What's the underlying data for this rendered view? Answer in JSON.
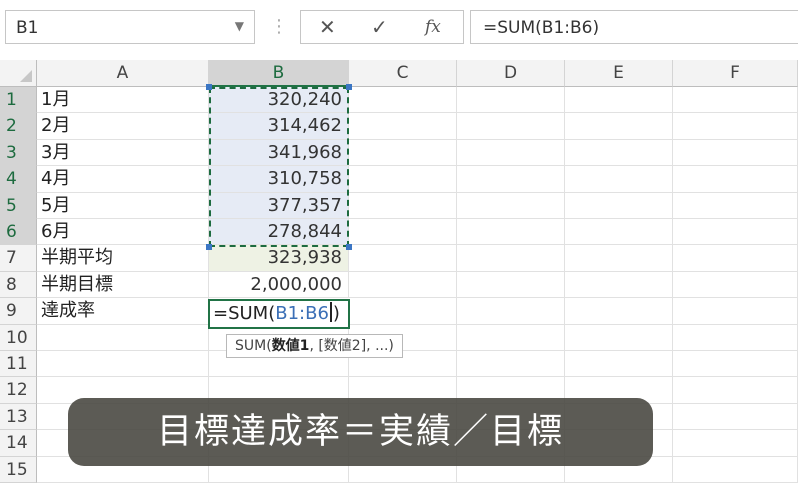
{
  "formula_bar": {
    "name_box": "B1",
    "cancel_icon": "✕",
    "enter_icon": "✓",
    "function_icon": "fx",
    "formula": "=SUM(B1:B6)"
  },
  "columns": [
    "A",
    "B",
    "C",
    "D",
    "E",
    "F"
  ],
  "rows": [
    "1",
    "2",
    "3",
    "4",
    "5",
    "6",
    "7",
    "8",
    "9",
    "10",
    "11",
    "12",
    "13",
    "14",
    "15"
  ],
  "cells": {
    "a": [
      "1月",
      "2月",
      "3月",
      "4月",
      "5月",
      "6月",
      "半期平均",
      "半期目標",
      "達成率"
    ],
    "b": [
      "320,240",
      "314,462",
      "341,968",
      "310,758",
      "377,357",
      "278,844",
      "323,938",
      "2,000,000"
    ]
  },
  "active_cell": {
    "prefix": "=SUM(",
    "ref": "B1:B6",
    "suffix": ")"
  },
  "tooltip": {
    "fn": "SUM(",
    "arg1": "数値1",
    "rest": ", [数値2], ...)"
  },
  "caption": "目標達成率＝実績／目標",
  "colors": {
    "selection_green": "#217346",
    "range_fill": "#e6ebf5",
    "caption_bg": "#46443e"
  }
}
